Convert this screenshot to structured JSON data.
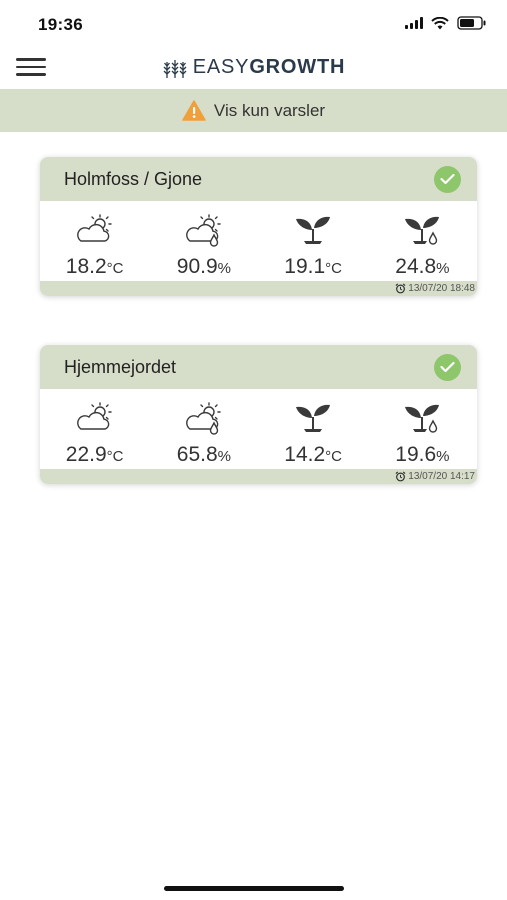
{
  "status_bar": {
    "time": "19:36"
  },
  "header": {
    "logo_light": "EASY",
    "logo_bold": "GROWTH",
    "menu_icon": "hamburger-menu-icon",
    "logo_icon": "wheat-icon"
  },
  "alert_filter": {
    "label": "Vis kun varsler",
    "icon": "warning-triangle-icon",
    "icon_color": "#f0a03a"
  },
  "colors": {
    "accent_bg": "#d6dec9",
    "ok_green": "#8ec66b",
    "icon_dark": "#3a3a3a"
  },
  "stations": [
    {
      "name": "Holmfoss / Gjone",
      "status_icon": "check-circle-icon",
      "metrics": [
        {
          "icon": "partly-sunny-icon",
          "value": "18.2",
          "unit": "°C"
        },
        {
          "icon": "partly-sunny-humidity-icon",
          "value": "90.9",
          "unit": "%"
        },
        {
          "icon": "seedling-icon",
          "value": "19.1",
          "unit": "°C"
        },
        {
          "icon": "seedling-moisture-icon",
          "value": "24.8",
          "unit": "%"
        }
      ],
      "timestamp": "13/07/20 18:48"
    },
    {
      "name": "Hjemmejordet",
      "status_icon": "check-circle-icon",
      "metrics": [
        {
          "icon": "partly-sunny-icon",
          "value": "22.9",
          "unit": "°C"
        },
        {
          "icon": "partly-sunny-humidity-icon",
          "value": "65.8",
          "unit": "%"
        },
        {
          "icon": "seedling-icon",
          "value": "14.2",
          "unit": "°C"
        },
        {
          "icon": "seedling-moisture-icon",
          "value": "19.6",
          "unit": "%"
        }
      ],
      "timestamp": "13/07/20 14:17"
    }
  ]
}
